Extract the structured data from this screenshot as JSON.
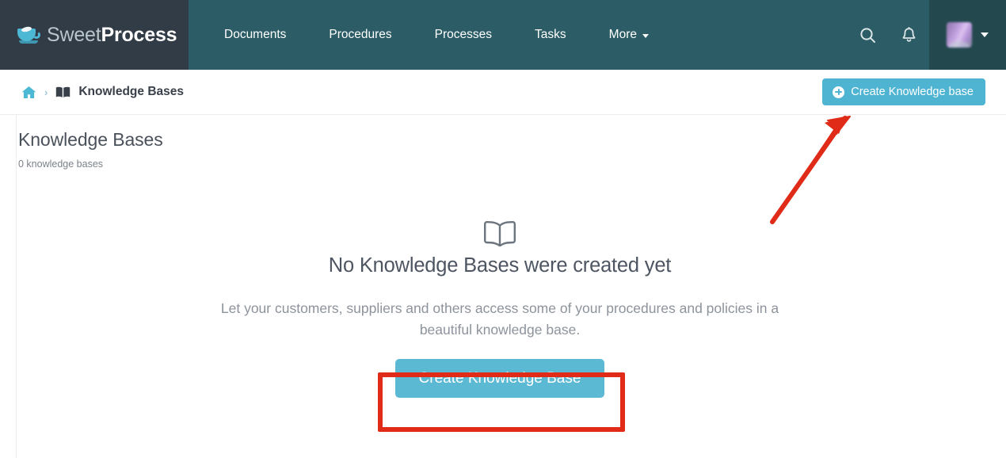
{
  "navbar": {
    "brand": {
      "sweet": "Sweet",
      "process": "Process",
      "icon": "coffee-cup-icon"
    },
    "links": [
      {
        "label": "Documents",
        "has_caret": false
      },
      {
        "label": "Procedures",
        "has_caret": false
      },
      {
        "label": "Processes",
        "has_caret": false
      },
      {
        "label": "Tasks",
        "has_caret": false
      },
      {
        "label": "More",
        "has_caret": true
      }
    ],
    "icons": [
      {
        "name": "search-icon"
      },
      {
        "name": "bell-icon"
      }
    ],
    "avatar": {
      "name": "user-avatar",
      "caret": "chevron-down-icon"
    },
    "colors": {
      "brand_block": "#323c47",
      "nav_bg": "#2c5d66",
      "avatar_bg": "#23494f"
    }
  },
  "breadcrumb": {
    "home_icon": "home-icon",
    "separator": "›",
    "book_icon": "book-icon",
    "label": "Knowledge Bases",
    "create_button": "Create Knowledge base"
  },
  "page": {
    "title": "Knowledge Bases",
    "count": "0 knowledge bases"
  },
  "empty_state": {
    "icon": "open-book-icon",
    "title": "No Knowledge Bases were created yet",
    "description": "Let your customers, suppliers and others access some of your procedures and policies in a beautiful knowledge base.",
    "button": "Create Knowledge Base"
  },
  "annotations": {
    "highlight_color": "#e02b18",
    "arrow": "red-arrow-pointing-to-create-knowledge-base-button",
    "rectangle": "red-rectangle-around-create-knowledge-base-button"
  },
  "colors": {
    "primary_button": "#5cb9d4",
    "header_button": "#4fb4d2",
    "accent_teal": "#4cb8d4",
    "annotation_red": "#e02b18"
  }
}
